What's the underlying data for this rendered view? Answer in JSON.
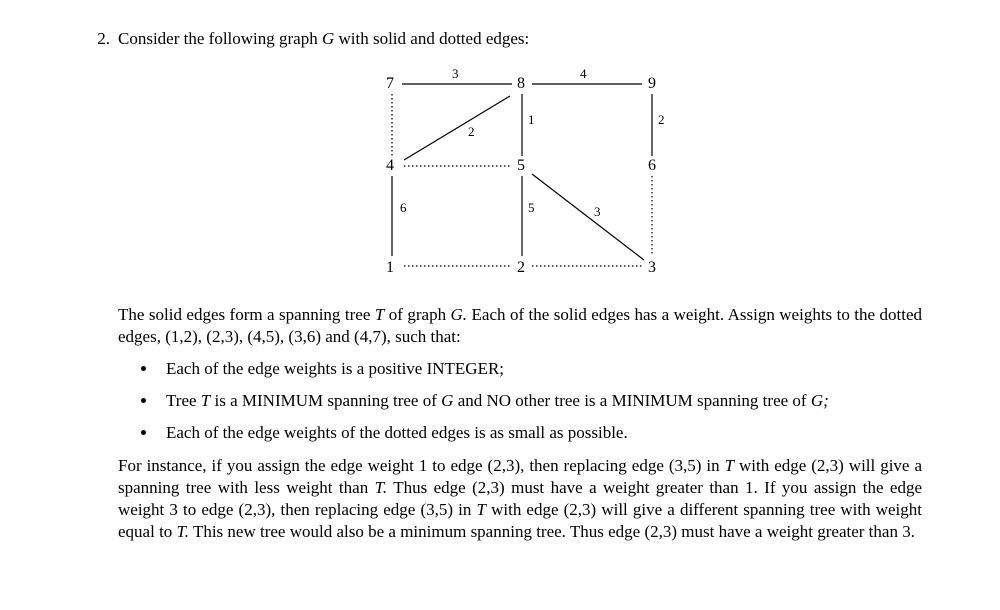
{
  "problem_number": "2.",
  "intro_prefix": "Consider the following graph",
  "graph_var": "G",
  "intro_suffix": "with solid and dotted edges:",
  "nodes": {
    "n1": "1",
    "n2": "2",
    "n3": "3",
    "n4": "4",
    "n5": "5",
    "n6": "6",
    "n7": "7",
    "n8": "8",
    "n9": "9"
  },
  "weights": {
    "w78": "3",
    "w89": "4",
    "w85": "1",
    "w58": "2",
    "w96": "2",
    "w41": "6",
    "w52": "5",
    "w53": "3"
  },
  "para1_a": "The solid edges form a spanning tree",
  "para1_T": "T",
  "para1_b": "of graph",
  "para1_G": "G.",
  "para1_c": "Each of the solid edges has a weight. Assign weights to the dotted edges, (1,2), (2,3), (4,5), (3,6) and (4,7), such that:",
  "bullet1": "Each of the edge weights is a positive INTEGER;",
  "bullet2_a": "Tree",
  "bullet2_T": "T",
  "bullet2_b": "is a MINIMUM spanning tree of",
  "bullet2_G": "G",
  "bullet2_c": "and NO other tree is a MINIMUM spanning tree of",
  "bullet2_G2": "G;",
  "bullet3": "Each of the edge weights of the dotted edges is as small as possible.",
  "para2_a": "For instance, if you assign the edge weight 1 to edge (2,3), then replacing edge (3,5) in",
  "para2_T": "T",
  "para2_b": "with edge (2,3) will give a spanning tree with less weight than",
  "para2_T2": "T.",
  "para2_c": "Thus edge (2,3) must have a weight greater than 1. If you assign the edge weight 3 to edge (2,3), then replacing edge (3,5) in",
  "para2_T3": "T",
  "para2_d": "with edge (2,3) will give a different spanning tree with weight equal to",
  "para2_T4": "T.",
  "para2_e": "This new tree would also be a minimum spanning tree. Thus edge (2,3) must have a weight greater than 3."
}
